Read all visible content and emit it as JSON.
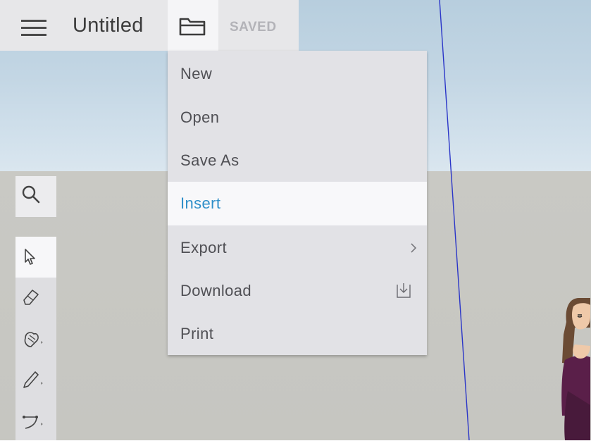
{
  "header": {
    "title": "Untitled",
    "status": "SAVED"
  },
  "file_menu": {
    "items": [
      {
        "label": "New"
      },
      {
        "label": "Open"
      },
      {
        "label": "Save As"
      },
      {
        "label": "Insert",
        "highlighted": true
      },
      {
        "label": "Export",
        "icon": "chevron-right-icon"
      },
      {
        "label": "Download",
        "icon": "download-icon"
      },
      {
        "label": "Print"
      }
    ]
  },
  "toolbar": {
    "tools": [
      {
        "name": "search-icon"
      },
      {
        "name": "select-arrow-icon",
        "active": true
      },
      {
        "name": "eraser-icon"
      },
      {
        "name": "paint-bucket-icon"
      },
      {
        "name": "pencil-icon"
      },
      {
        "name": "arc-icon"
      }
    ]
  },
  "colors": {
    "accent": "#2f8fc9",
    "sky": "#c3d6e4",
    "ground": "#c6c6c1",
    "axis": "#1f2fd0"
  }
}
